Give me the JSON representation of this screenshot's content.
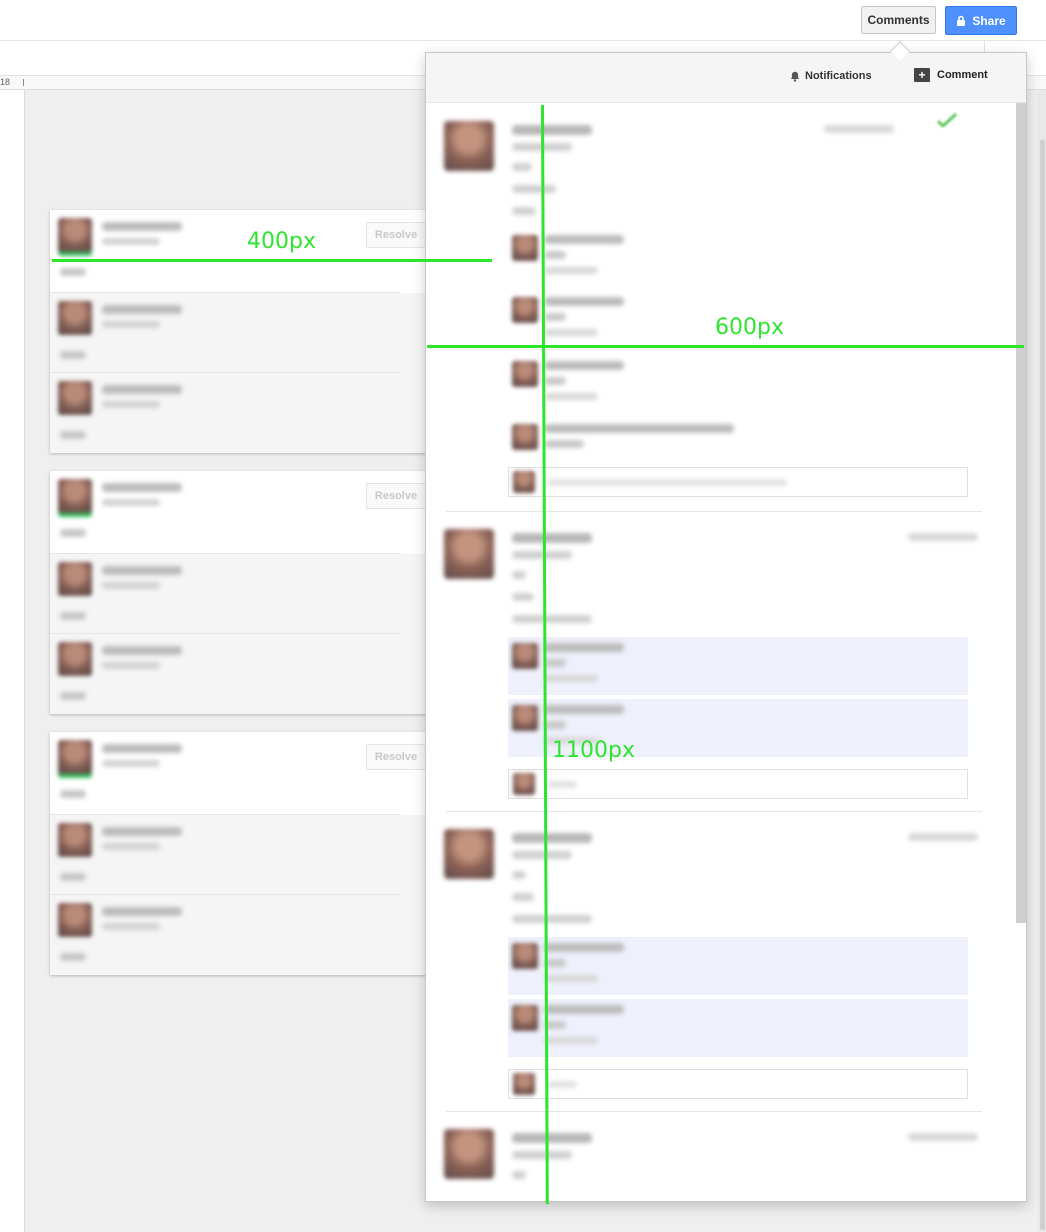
{
  "header": {
    "comments_label": "Comments",
    "share_label": "Share"
  },
  "ruler": {
    "number": "18"
  },
  "left_threads": [
    {
      "resolve_label": "Resolve"
    },
    {
      "resolve_label": "Resolve"
    },
    {
      "resolve_label": "Resolve"
    }
  ],
  "comments_panel": {
    "notifications_label": "Notifications",
    "comment_label": "Comment"
  },
  "annotations": {
    "width_400": "400px",
    "width_600": "600px",
    "height_1100": "1100px",
    "guide_color": "#2ee52e"
  },
  "colors": {
    "share_blue": "#4d90fe",
    "reply_tint": "#eef0fb",
    "green_marker": "#2fbf5a"
  },
  "icons": [
    "lock-icon",
    "bell-icon",
    "add-comment-icon",
    "check-icon"
  ]
}
